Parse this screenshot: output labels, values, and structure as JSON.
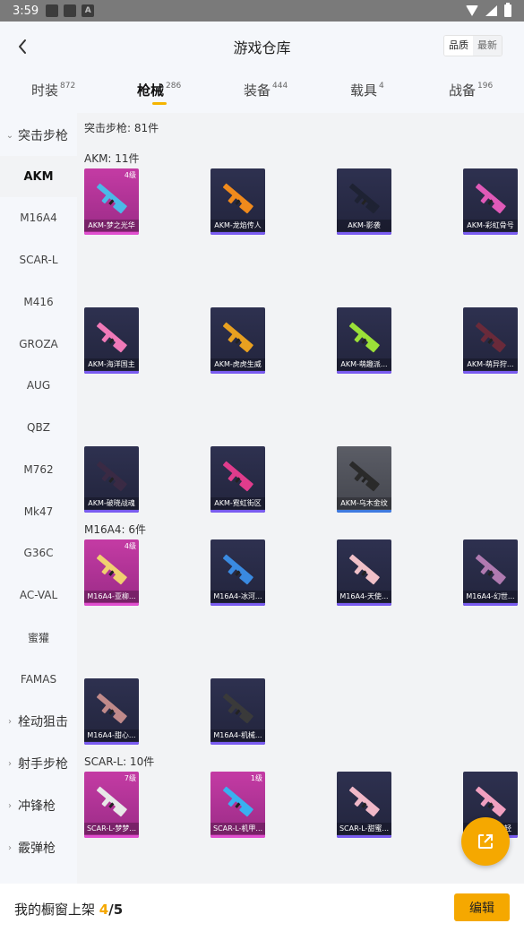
{
  "status_bar": {
    "time": "3:59",
    "notif_a": "A"
  },
  "header": {
    "title": "游戏仓库",
    "sort_quality": "品质",
    "sort_newest": "最新"
  },
  "tabs": [
    {
      "label": "时装",
      "count": "872"
    },
    {
      "label": "枪械",
      "count": "286"
    },
    {
      "label": "装备",
      "count": "444"
    },
    {
      "label": "载具",
      "count": "4"
    },
    {
      "label": "战备",
      "count": "196"
    }
  ],
  "sidebar": {
    "group_assault": "突击步枪",
    "items": [
      "AKM",
      "M16A4",
      "SCAR-L",
      "M416",
      "GROZA",
      "AUG",
      "QBZ",
      "M762",
      "Mk47",
      "G36C",
      "AC-VAL",
      "蜜獾",
      "FAMAS"
    ],
    "group_bolt": "栓动狙击",
    "group_marksman": "射手步枪",
    "group_smg": "冲锋枪",
    "group_shotgun": "霰弹枪"
  },
  "content": {
    "category_header": "突击步枪: 81件",
    "sections": [
      {
        "title": "AKM: 11件",
        "cards": [
          {
            "name": "AKM-梦之光华",
            "level": "4级",
            "color": "purple",
            "gun": "#4bb9e8"
          },
          {
            "name": "AKM-龙焰传人",
            "level": "",
            "color": "dark",
            "gun": "#f08a1c"
          },
          {
            "name": "AKM-影袭",
            "level": "",
            "color": "dark",
            "gun": "#1e2233"
          },
          {
            "name": "AKM-彩虹骨号",
            "level": "",
            "color": "dark",
            "gun": "#e05ab8"
          },
          {
            "name": "AKM-海洋国主",
            "level": "",
            "color": "dark",
            "gun": "#f07ab8"
          },
          {
            "name": "AKM-虎虎生威",
            "level": "",
            "color": "dark",
            "gun": "#e8a020"
          },
          {
            "name": "AKM-萌趣派...",
            "level": "",
            "color": "dark",
            "gun": "#9be038"
          },
          {
            "name": "AKM-萌异狩...",
            "level": "",
            "color": "dark",
            "gun": "#6a2a3a"
          },
          {
            "name": "AKM-破晓战魂",
            "level": "",
            "color": "dark",
            "gun": "#3a2a44"
          },
          {
            "name": "AKM-霓虹街区",
            "level": "",
            "color": "dark",
            "gun": "#e03c8c"
          },
          {
            "name": "AKM-乌木金纹",
            "level": "",
            "color": "gray",
            "gun": "#2a2a2a"
          }
        ]
      },
      {
        "title": "M16A4: 6件",
        "cards": [
          {
            "name": "M16A4-亚柳...",
            "level": "4级",
            "color": "purple",
            "gun": "#f0d070"
          },
          {
            "name": "M16A4-冰河...",
            "level": "",
            "color": "dark",
            "gun": "#3a8ae0"
          },
          {
            "name": "M16A4-天使...",
            "level": "",
            "color": "dark",
            "gun": "#f0c0c8"
          },
          {
            "name": "M16A4-幻世...",
            "level": "",
            "color": "dark",
            "gun": "#b07ab0"
          },
          {
            "name": "M16A4-甜心...",
            "level": "",
            "color": "dark",
            "gun": "#c08a8a"
          },
          {
            "name": "M16A4-机械...",
            "level": "",
            "color": "dark",
            "gun": "#3a3a3a"
          }
        ]
      },
      {
        "title": "SCAR-L: 10件",
        "cards": [
          {
            "name": "SCAR-L-梦梦...",
            "level": "7级",
            "color": "purple",
            "gun": "#e8e8e8"
          },
          {
            "name": "SCAR-L-机甲...",
            "level": "1级",
            "color": "purple",
            "gun": "#3ab0f0"
          },
          {
            "name": "SCAR-L-甜蜜...",
            "level": "",
            "color": "dark",
            "gun": "#f0b8c8"
          },
          {
            "name": "SCAR-L-...轻",
            "level": "",
            "color": "dark",
            "gun": "#f0a0c0"
          }
        ]
      }
    ]
  },
  "bottom": {
    "label": "我的橱窗上架",
    "current": "4",
    "sep_total": "/5",
    "edit": "编辑"
  }
}
